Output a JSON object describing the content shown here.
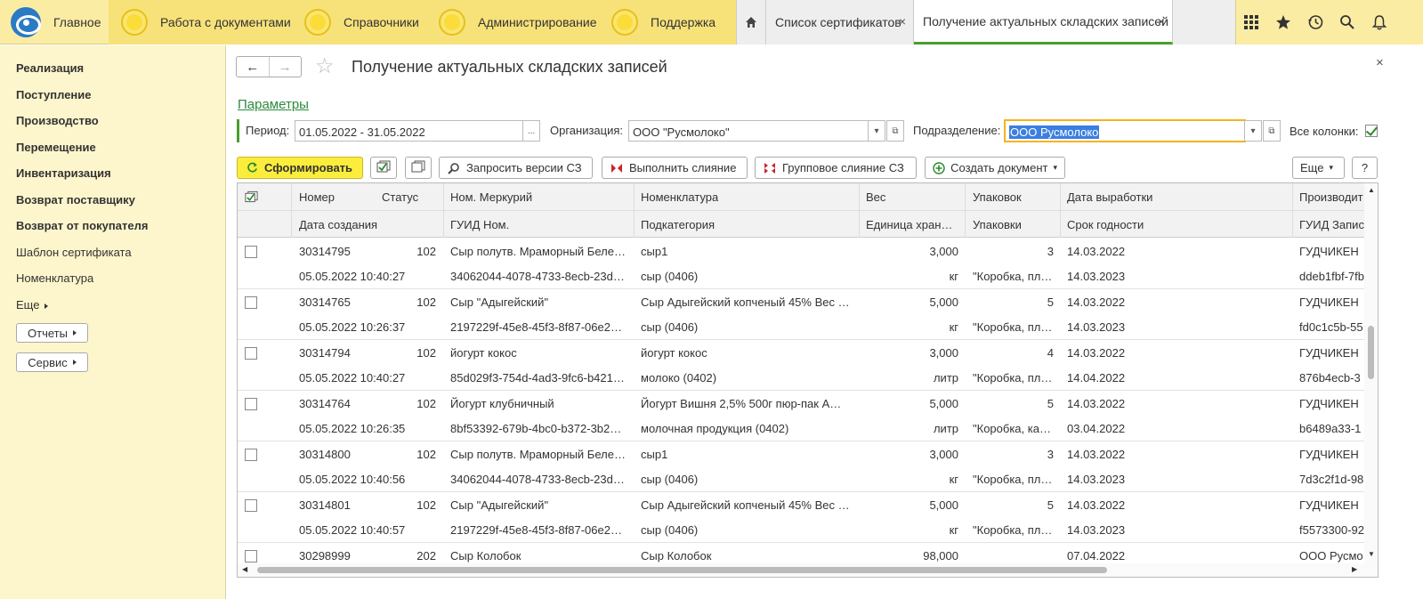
{
  "topbar": {
    "main_label": "Главное",
    "sections": [
      "Работа с документами",
      "Справочники",
      "Администрирование",
      "Поддержка"
    ],
    "tabs": [
      {
        "label": "Список сертификатов"
      },
      {
        "label": "Получение актуальных складских записей"
      }
    ],
    "close_glyph": "×",
    "icons": [
      "apps-grid-icon",
      "star-icon",
      "history-icon",
      "search-icon",
      "bell-icon"
    ]
  },
  "sidebar": {
    "bold_items": [
      "Реализация",
      "Поступление",
      "Производство",
      "Перемещение",
      "Инвентаризация",
      "Возврат поставщику",
      "Возврат от покупателя"
    ],
    "items": [
      "Шаблон сертификата",
      "Номенклатура",
      "Еще"
    ],
    "buttons": [
      "Отчеты",
      "Сервис"
    ]
  },
  "form": {
    "title": "Получение актуальных складских записей",
    "params_link": "Параметры",
    "period_label": "Период:",
    "period_value": "01.05.2022 - 31.05.2022",
    "period_btn": "...",
    "org_label": "Организация:",
    "org_value": "ООО \"Русмолоко\"",
    "dept_label": "Подразделение:",
    "dept_value": "ООО Русмолоко",
    "all_cols_label": "Все колонки:",
    "all_cols_checked": true
  },
  "toolbar": {
    "generate": "Сформировать",
    "request_versions": "Запросить версии СЗ",
    "merge": "Выполнить слияние",
    "group_merge": "Групповое слияние СЗ",
    "create_doc": "Создать документ",
    "more": "Еще",
    "help": "?"
  },
  "table": {
    "headers_row1": [
      "Номер",
      "Статус",
      "Ном. Меркурий",
      "Номенклатура",
      "Вес",
      "Упаковок",
      "Дата выработки",
      "Производит"
    ],
    "headers_row2": [
      "Дата создания",
      "ГУИД Ном.",
      "Подкатегория",
      "Единица хран…",
      "Упаковки",
      "Срок годности",
      "ГУИД Запис"
    ],
    "rows": [
      {
        "num": "30314795",
        "status": "102",
        "merc": "Сыр полутв. Мраморный Беле…",
        "nom": "сыр1",
        "weight": "3,000",
        "packs": "3",
        "prod_date": "14.03.2022",
        "producer": "ГУДЧИКЕН",
        "created": "05.05.2022 10:40:27",
        "guid": "34062044-4078-4733-8ecb-23d…",
        "subcat": "сыр (0406)",
        "unit": "кг",
        "pack": "\"Коробка, пл…",
        "expiry": "14.03.2023",
        "rec_guid": "ddeb1fbf-7fb"
      },
      {
        "num": "30314765",
        "status": "102",
        "merc": "Сыр \"Адыгейский\"",
        "nom": "Сыр Адыгейский копченый 45% Вес …",
        "weight": "5,000",
        "packs": "5",
        "prod_date": "14.03.2022",
        "producer": "ГУДЧИКЕН",
        "created": "05.05.2022 10:26:37",
        "guid": "2197229f-45e8-45f3-8f87-06e2…",
        "subcat": "сыр (0406)",
        "unit": "кг",
        "pack": "\"Коробка, пл…",
        "expiry": "14.03.2023",
        "rec_guid": "fd0c1c5b-55"
      },
      {
        "num": "30314794",
        "status": "102",
        "merc": "йогурт кокос",
        "nom": "йогурт кокос",
        "weight": "3,000",
        "packs": "4",
        "prod_date": "14.03.2022",
        "producer": "ГУДЧИКЕН",
        "created": "05.05.2022 10:40:27",
        "guid": "85d029f3-754d-4ad3-9fc6-b421…",
        "subcat": "молоко (0402)",
        "unit": "литр",
        "pack": "\"Коробка, пл…",
        "expiry": "14.04.2022",
        "rec_guid": "876b4ecb-3"
      },
      {
        "num": "30314764",
        "status": "102",
        "merc": "Йогурт клубничный",
        "nom": "Йогурт  Вишня 2,5% 500г пюр-пак А…",
        "weight": "5,000",
        "packs": "5",
        "prod_date": "14.03.2022",
        "producer": "ГУДЧИКЕН",
        "created": "05.05.2022 10:26:35",
        "guid": "8bf53392-679b-4bc0-b372-3b2…",
        "subcat": "молочная продукция (0402)",
        "unit": "литр",
        "pack": "\"Коробка, ка…",
        "expiry": "03.04.2022",
        "rec_guid": "b6489a33-1"
      },
      {
        "num": "30314800",
        "status": "102",
        "merc": "Сыр полутв. Мраморный Беле…",
        "nom": "сыр1",
        "weight": "3,000",
        "packs": "3",
        "prod_date": "14.03.2022",
        "producer": "ГУДЧИКЕН",
        "created": "05.05.2022 10:40:56",
        "guid": "34062044-4078-4733-8ecb-23d…",
        "subcat": "сыр (0406)",
        "unit": "кг",
        "pack": "\"Коробка, пл…",
        "expiry": "14.03.2023",
        "rec_guid": "7d3c2f1d-98"
      },
      {
        "num": "30314801",
        "status": "102",
        "merc": "Сыр \"Адыгейский\"",
        "nom": "Сыр Адыгейский копченый 45% Вес …",
        "weight": "5,000",
        "packs": "5",
        "prod_date": "14.03.2022",
        "producer": "ГУДЧИКЕН",
        "created": "05.05.2022 10:40:57",
        "guid": "2197229f-45e8-45f3-8f87-06e2…",
        "subcat": "сыр (0406)",
        "unit": "кг",
        "pack": "\"Коробка, пл…",
        "expiry": "14.03.2023",
        "rec_guid": "f5573300-92"
      },
      {
        "num": "30298999",
        "status": "202",
        "merc": "Сыр Колобок",
        "nom": "Сыр Колобок",
        "weight": "98,000",
        "packs": "",
        "prod_date": "07.04.2022",
        "producer": "ООО Русмо",
        "created": "",
        "guid": "",
        "subcat": "",
        "unit": "",
        "pack": "",
        "expiry": "",
        "rec_guid": ""
      }
    ]
  },
  "colors": {
    "accent_green": "#4a9e2c",
    "topbar": "#fbeca4",
    "sidebar": "#fdf6cc",
    "primary_btn": "#fbed3c",
    "highlight": "#f5b31b"
  }
}
